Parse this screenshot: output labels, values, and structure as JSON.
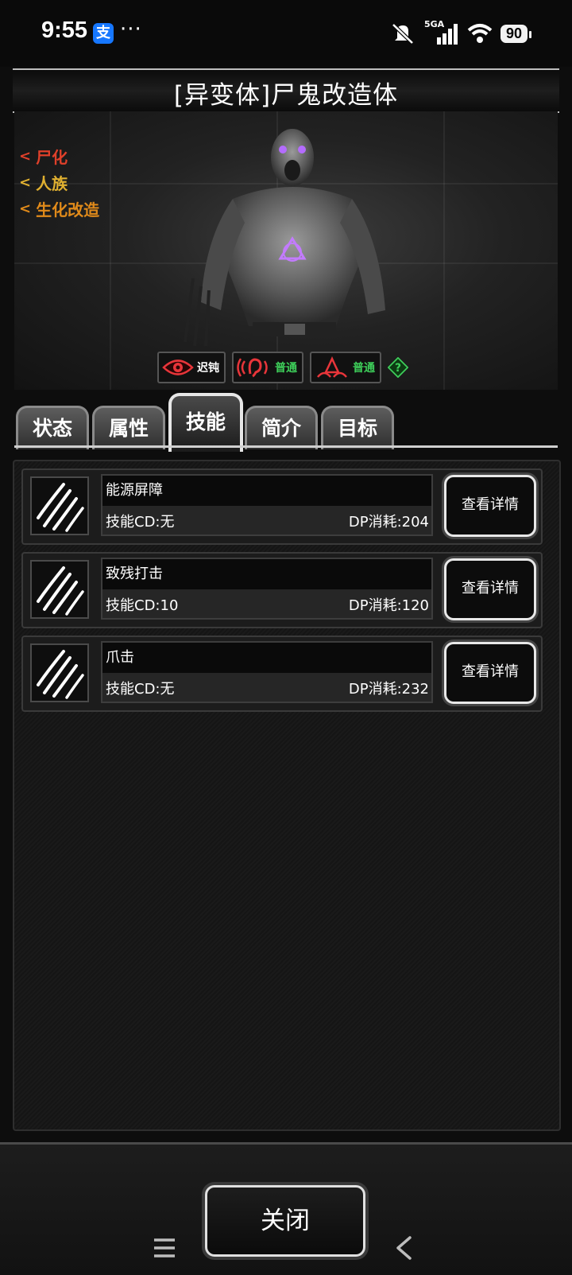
{
  "status_bar": {
    "time": "9:55",
    "app_icon_glyph": "支",
    "more": "···",
    "network": "5GA",
    "battery": "90"
  },
  "window_title": "[异变体]尸鬼改造体",
  "traits": [
    {
      "label": "尸化",
      "color": "#e0402a"
    },
    {
      "label": "人族",
      "color": "#e0b030"
    },
    {
      "label": "生化改造",
      "color": "#e08a1a"
    }
  ],
  "tags": [
    {
      "icon": "eye-icon",
      "label": "迟钝",
      "color": "#ffffff"
    },
    {
      "icon": "ear-icon",
      "label": "普通",
      "color": "#3ecf5a"
    },
    {
      "icon": "smell-icon",
      "label": "普通",
      "color": "#3ecf5a"
    },
    {
      "icon": "help-icon",
      "label": "?"
    }
  ],
  "tabs": [
    {
      "label": "状态",
      "active": false
    },
    {
      "label": "属性",
      "active": false
    },
    {
      "label": "技能",
      "active": true
    },
    {
      "label": "简介",
      "active": false
    },
    {
      "label": "目标",
      "active": false
    }
  ],
  "skills": [
    {
      "name": "能源屏障",
      "cd": "技能CD:无",
      "dp": "DP消耗:204",
      "detail_label": "查看详情",
      "icon": "claw-icon"
    },
    {
      "name": "致残打击",
      "cd": "技能CD:10",
      "dp": "DP消耗:120",
      "detail_label": "查看详情",
      "icon": "claw-icon"
    },
    {
      "name": "爪击",
      "cd": "技能CD:无",
      "dp": "DP消耗:232",
      "detail_label": "查看详情",
      "icon": "claw-icon"
    }
  ],
  "close_label": "关闭",
  "nav": [
    "menu-icon",
    "home-icon",
    "back-icon"
  ]
}
